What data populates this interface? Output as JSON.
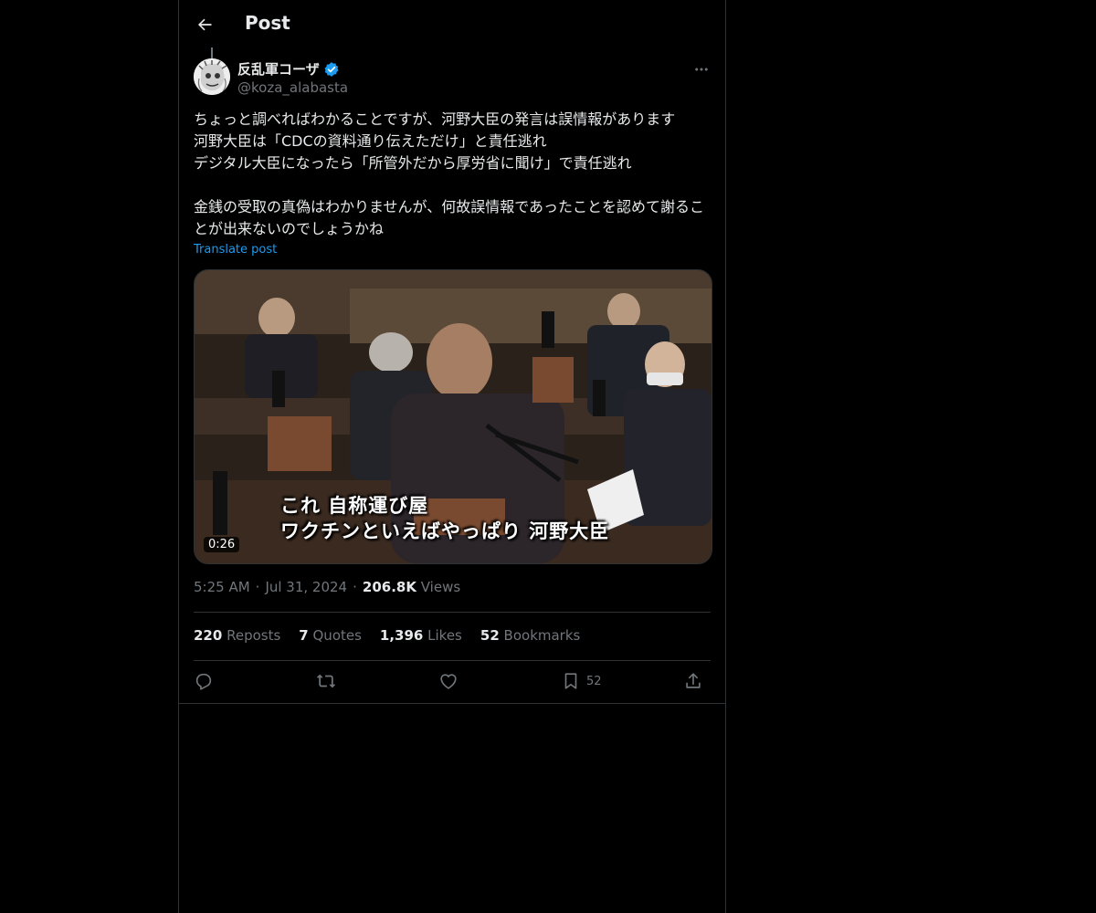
{
  "header": {
    "title": "Post",
    "back_icon": "arrow-left-icon"
  },
  "author": {
    "display_name": "反乱軍コーザ",
    "handle": "@koza_alabasta",
    "verified_icon": "verified-badge-icon",
    "verified_color": "#1d9bf0"
  },
  "post": {
    "text": "ちょっと調べればわかることですが、河野大臣の発言は誤情報があります\n河野大臣は「CDCの資料通り伝えただけ」と責任逃れ\nデジタル大臣になったら「所管外だから厚労省に聞け」で責任逃れ\n\n金銭の受取の真偽はわかりませんが、何故誤情報であったことを認めて謝ることが出来ないのでしょうかね",
    "translate_label": "Translate post",
    "video": {
      "caption_line1": "これ 自称運び屋",
      "caption_line2": "ワクチンといえばやっぱり 河野大臣",
      "duration": "0:26"
    },
    "time": "5:25 AM",
    "date": "Jul 31, 2024",
    "views_count": "206.8K",
    "views_label": "Views"
  },
  "stats": {
    "reposts_count": "220",
    "reposts_label": "Reposts",
    "quotes_count": "7",
    "quotes_label": "Quotes",
    "likes_count": "1,396",
    "likes_label": "Likes",
    "bookmarks_count": "52",
    "bookmarks_label": "Bookmarks"
  },
  "actions": {
    "reply_icon": "reply-icon",
    "repost_icon": "repost-icon",
    "like_icon": "heart-icon",
    "bookmark_icon": "bookmark-icon",
    "bookmark_count": "52",
    "share_icon": "share-icon"
  },
  "colors": {
    "accent": "#1d9bf0",
    "background": "#000000",
    "muted": "#71767b",
    "border": "#2f3336"
  }
}
